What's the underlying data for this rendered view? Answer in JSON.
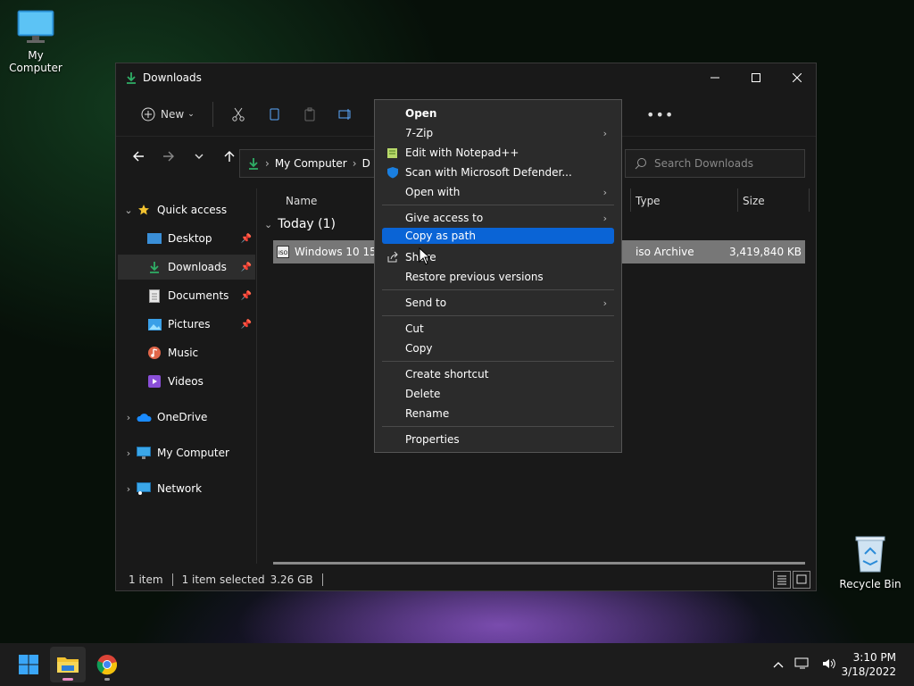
{
  "desktop": {
    "icons": [
      {
        "label": "My Computer"
      },
      {
        "label": "Recycle Bin"
      }
    ]
  },
  "window": {
    "title": "Downloads",
    "toolbar": {
      "new_label": "New"
    },
    "address": {
      "root": "My Computer",
      "current_fragment": "D"
    },
    "search": {
      "placeholder": "Search Downloads"
    },
    "sidebar": {
      "quick_access": "Quick access",
      "items": [
        {
          "label": "Desktop"
        },
        {
          "label": "Downloads"
        },
        {
          "label": "Documents"
        },
        {
          "label": "Pictures"
        },
        {
          "label": "Music"
        },
        {
          "label": "Videos"
        }
      ],
      "onedrive": "OneDrive",
      "my_computer": "My Computer",
      "network": "Network"
    },
    "columns": {
      "name": "Name",
      "type": "Type",
      "size": "Size"
    },
    "group": "Today (1)",
    "file": {
      "name": "Windows 10 1507",
      "type": "iso Archive",
      "size": "3,419,840 KB"
    },
    "status": {
      "count": "1 item",
      "selected": "1 item selected",
      "selected_size": "3.26 GB"
    }
  },
  "context_menu": {
    "items": [
      {
        "label": "Open"
      },
      {
        "label": "7-Zip"
      },
      {
        "label": "Edit with Notepad++"
      },
      {
        "label": "Scan with Microsoft Defender..."
      },
      {
        "label": "Open with"
      },
      {
        "label": "Give access to"
      },
      {
        "label": "Copy as path"
      },
      {
        "label": "Share"
      },
      {
        "label": "Restore previous versions"
      },
      {
        "label": "Send to"
      },
      {
        "label": "Cut"
      },
      {
        "label": "Copy"
      },
      {
        "label": "Create shortcut"
      },
      {
        "label": "Delete"
      },
      {
        "label": "Rename"
      },
      {
        "label": "Properties"
      }
    ]
  },
  "taskbar": {
    "time": "3:10 PM",
    "date": "3/18/2022"
  },
  "colors": {
    "accent": "#0a64d6",
    "folder_green": "#2fae66",
    "selection": "#777777"
  }
}
